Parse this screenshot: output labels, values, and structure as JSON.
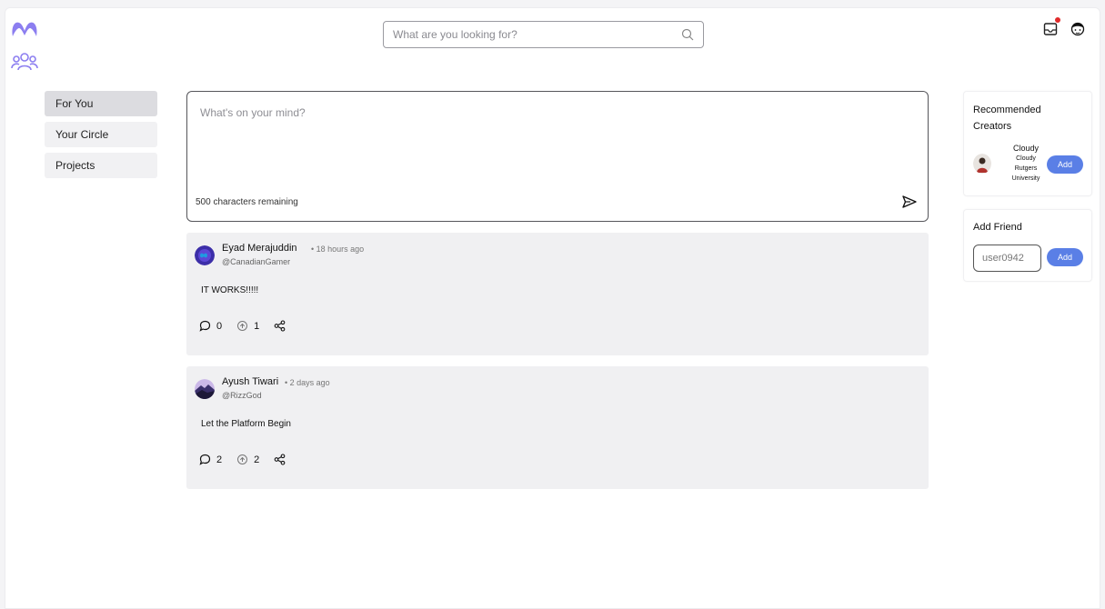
{
  "header": {
    "logo_icon": "m-logo-icon",
    "circle_icon": "group-icon",
    "search": {
      "placeholder": "What are you looking for?",
      "value": "",
      "icon": "search-icon"
    },
    "inbox_icon": "inbox-icon",
    "profile_icon": "profile-face-icon",
    "accent_color": "#8c7ef0",
    "notification_color": "#e02a2a"
  },
  "nav": {
    "items": [
      {
        "label": "For You",
        "active": true
      },
      {
        "label": "Your Circle",
        "active": false
      },
      {
        "label": "Projects",
        "active": false
      }
    ]
  },
  "composer": {
    "placeholder": "What's on your mind?",
    "value": "",
    "char_remaining": "500 characters remaining",
    "send_icon": "send-icon"
  },
  "posts": [
    {
      "author": "Eyad Merajuddin",
      "time": "• 18 hours ago",
      "handle": "@CanadianGamer",
      "body": "IT WORKS!!!!!",
      "comments": "0",
      "upvotes": "1"
    },
    {
      "author": "Ayush Tiwari",
      "time": "• 2 days ago",
      "handle": "@RizzGod",
      "body": "Let the Platform Begin",
      "comments": "2",
      "upvotes": "2"
    }
  ],
  "sidebar": {
    "recommended": {
      "title": "Recommended Creators",
      "creator": {
        "name": "Cloudy",
        "username": "Cloudy",
        "school": "Rutgers University"
      },
      "add_label": "Add"
    },
    "add_friend": {
      "title": "Add Friend",
      "placeholder": "user0942",
      "value": "",
      "add_label": "Add"
    },
    "button_color": "#5a7fe6"
  }
}
